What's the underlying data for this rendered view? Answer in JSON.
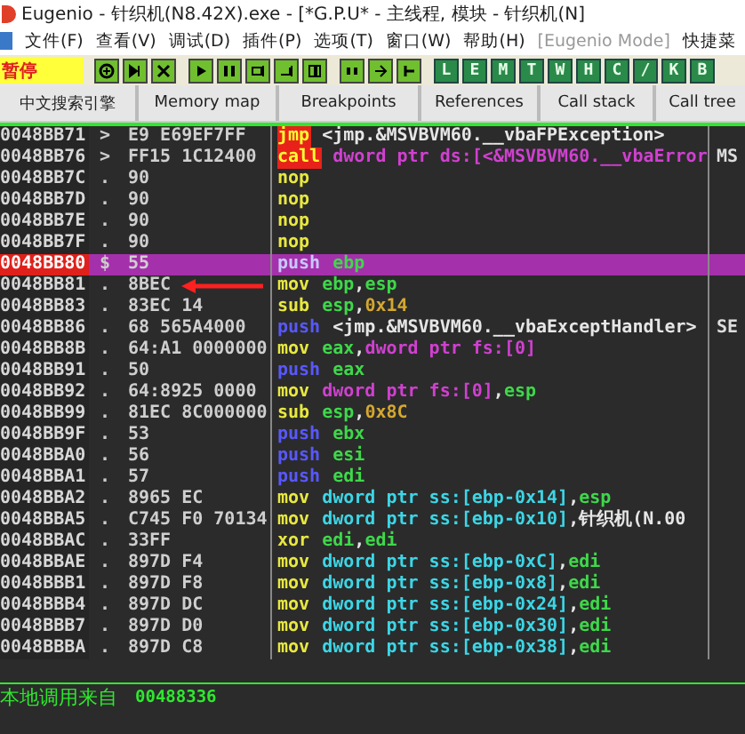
{
  "window": {
    "title": "Eugenio - 针织机(N8.42X).exe - [*G.P.U* - 主线程, 模块 - 针织机(N]"
  },
  "menu": [
    "文件(F)",
    "查看(V)",
    "调试(D)",
    "插件(P)",
    "选项(T)",
    "窗口(W)",
    "帮助(H)",
    "[Eugenio Mode]",
    "快捷菜"
  ],
  "toolbar": {
    "status": "暂停",
    "buttons": [
      {
        "kind": "icon"
      },
      {
        "kind": "icon"
      },
      {
        "kind": "icon"
      },
      {
        "kind": "icon"
      },
      {
        "kind": "icon"
      },
      {
        "kind": "icon"
      },
      {
        "kind": "icon"
      },
      {
        "kind": "icon"
      },
      {
        "kind": "icon"
      },
      {
        "kind": "icon"
      },
      {
        "kind": "icon"
      },
      {
        "kind": "letter",
        "label": "L"
      },
      {
        "kind": "letter",
        "label": "E"
      },
      {
        "kind": "letter",
        "label": "M"
      },
      {
        "kind": "letter",
        "label": "T"
      },
      {
        "kind": "letter",
        "label": "W"
      },
      {
        "kind": "letter",
        "label": "H"
      },
      {
        "kind": "letter",
        "label": "C"
      },
      {
        "kind": "letter",
        "label": "/"
      },
      {
        "kind": "letter",
        "label": "K"
      },
      {
        "kind": "letter",
        "label": "B"
      }
    ]
  },
  "tabs": [
    {
      "label": "中文搜索引擎",
      "selected": false
    },
    {
      "label": "Memory map",
      "selected": false
    },
    {
      "label": "Breakpoints",
      "selected": false
    },
    {
      "label": "References",
      "selected": false
    },
    {
      "label": "Call stack",
      "selected": false
    },
    {
      "label": "Call tree",
      "selected": false
    }
  ],
  "disasm": {
    "rows": [
      {
        "address": "0048BB71",
        "marker": ">",
        "bytes": "E9 E69EF7FF",
        "mnemonic": "jmp",
        "kind": "flow",
        "operands": [
          {
            "text": "<jmp.&MSVBVM60.__vbaFPException>",
            "kind": "sym"
          }
        ],
        "selected": false
      },
      {
        "address": "0048BB76",
        "marker": ">",
        "bytes": "FF15 1C12400",
        "mnemonic": "call",
        "kind": "flow",
        "operands": [
          {
            "text": "dword ptr ds:[<&MSVBVM60.__vbaError",
            "kind": "seg"
          }
        ],
        "comment": "MS",
        "selected": false
      },
      {
        "address": "0048BB7C",
        "marker": ".",
        "bytes": "90",
        "mnemonic": "nop",
        "kind": "plain",
        "operands": [],
        "selected": false
      },
      {
        "address": "0048BB7D",
        "marker": ".",
        "bytes": "90",
        "mnemonic": "nop",
        "kind": "plain",
        "operands": [],
        "selected": false
      },
      {
        "address": "0048BB7E",
        "marker": ".",
        "bytes": "90",
        "mnemonic": "nop",
        "kind": "plain",
        "operands": [],
        "selected": false
      },
      {
        "address": "0048BB7F",
        "marker": ".",
        "bytes": "90",
        "mnemonic": "nop",
        "kind": "plain",
        "operands": [],
        "selected": false
      },
      {
        "address": "0048BB80",
        "marker": "$",
        "bytes": "55",
        "mnemonic": "push",
        "kind": "stack",
        "operands": [
          {
            "text": "ebp",
            "kind": "reg"
          }
        ],
        "selected": true
      },
      {
        "address": "0048BB81",
        "marker": ".",
        "bytes": "8BEC",
        "mnemonic": "mov",
        "kind": "plain",
        "operands": [
          {
            "text": "ebp",
            "kind": "reg"
          },
          {
            "text": ",",
            "kind": "sym"
          },
          {
            "text": "esp",
            "kind": "reg"
          }
        ],
        "selected": false
      },
      {
        "address": "0048BB83",
        "marker": ".",
        "bytes": "83EC 14",
        "mnemonic": "sub",
        "kind": "plain",
        "operands": [
          {
            "text": "esp",
            "kind": "reg"
          },
          {
            "text": ",",
            "kind": "sym"
          },
          {
            "text": "0x14",
            "kind": "imm"
          }
        ],
        "selected": false
      },
      {
        "address": "0048BB86",
        "marker": ".",
        "bytes": "68 565A4000",
        "mnemonic": "push",
        "kind": "stack",
        "operands": [
          {
            "text": "<jmp.&MSVBVM60.__vbaExceptHandler>",
            "kind": "sym"
          }
        ],
        "comment": "SE",
        "selected": false
      },
      {
        "address": "0048BB8B",
        "marker": ".",
        "bytes": "64:A1 0000000",
        "mnemonic": "mov",
        "kind": "plain",
        "operands": [
          {
            "text": "eax",
            "kind": "reg"
          },
          {
            "text": ",",
            "kind": "sym"
          },
          {
            "text": "dword ptr fs:[0]",
            "kind": "seg"
          }
        ],
        "selected": false
      },
      {
        "address": "0048BB91",
        "marker": ".",
        "bytes": "50",
        "mnemonic": "push",
        "kind": "stack",
        "operands": [
          {
            "text": "eax",
            "kind": "reg"
          }
        ],
        "selected": false
      },
      {
        "address": "0048BB92",
        "marker": ".",
        "bytes": "64:8925 0000",
        "mnemonic": "mov",
        "kind": "plain",
        "operands": [
          {
            "text": "dword ptr fs:[0]",
            "kind": "seg"
          },
          {
            "text": ",",
            "kind": "sym"
          },
          {
            "text": "esp",
            "kind": "reg"
          }
        ],
        "selected": false
      },
      {
        "address": "0048BB99",
        "marker": ".",
        "bytes": "81EC 8C000000",
        "mnemonic": "sub",
        "kind": "plain",
        "operands": [
          {
            "text": "esp",
            "kind": "reg"
          },
          {
            "text": ",",
            "kind": "sym"
          },
          {
            "text": "0x8C",
            "kind": "imm"
          }
        ],
        "selected": false
      },
      {
        "address": "0048BB9F",
        "marker": ".",
        "bytes": "53",
        "mnemonic": "push",
        "kind": "stack",
        "operands": [
          {
            "text": "ebx",
            "kind": "reg"
          }
        ],
        "selected": false
      },
      {
        "address": "0048BBA0",
        "marker": ".",
        "bytes": "56",
        "mnemonic": "push",
        "kind": "stack",
        "operands": [
          {
            "text": "esi",
            "kind": "reg"
          }
        ],
        "selected": false
      },
      {
        "address": "0048BBA1",
        "marker": ".",
        "bytes": "57",
        "mnemonic": "push",
        "kind": "stack",
        "operands": [
          {
            "text": "edi",
            "kind": "reg"
          }
        ],
        "selected": false
      },
      {
        "address": "0048BBA2",
        "marker": ".",
        "bytes": "8965 EC",
        "mnemonic": "mov",
        "kind": "plain",
        "operands": [
          {
            "text": "dword ptr ss:[ebp-0x14]",
            "kind": "mem"
          },
          {
            "text": ",",
            "kind": "sym"
          },
          {
            "text": "esp",
            "kind": "reg"
          }
        ],
        "selected": false
      },
      {
        "address": "0048BBA5",
        "marker": ".",
        "bytes": "C745 F0 70134",
        "mnemonic": "mov",
        "kind": "plain",
        "operands": [
          {
            "text": "dword ptr ss:[ebp-0x10]",
            "kind": "mem"
          },
          {
            "text": ",针织机(N.00",
            "kind": "sym"
          }
        ],
        "selected": false
      },
      {
        "address": "0048BBAC",
        "marker": ".",
        "bytes": "33FF",
        "mnemonic": "xor",
        "kind": "plain",
        "operands": [
          {
            "text": "edi",
            "kind": "reg"
          },
          {
            "text": ",",
            "kind": "sym"
          },
          {
            "text": "edi",
            "kind": "reg"
          }
        ],
        "selected": false
      },
      {
        "address": "0048BBAE",
        "marker": ".",
        "bytes": "897D F4",
        "mnemonic": "mov",
        "kind": "plain",
        "operands": [
          {
            "text": "dword ptr ss:[ebp-0xC]",
            "kind": "mem"
          },
          {
            "text": ",",
            "kind": "sym"
          },
          {
            "text": "edi",
            "kind": "reg"
          }
        ],
        "selected": false
      },
      {
        "address": "0048BBB1",
        "marker": ".",
        "bytes": "897D F8",
        "mnemonic": "mov",
        "kind": "plain",
        "operands": [
          {
            "text": "dword ptr ss:[ebp-0x8]",
            "kind": "mem"
          },
          {
            "text": ",",
            "kind": "sym"
          },
          {
            "text": "edi",
            "kind": "reg"
          }
        ],
        "selected": false
      },
      {
        "address": "0048BBB4",
        "marker": ".",
        "bytes": "897D DC",
        "mnemonic": "mov",
        "kind": "plain",
        "operands": [
          {
            "text": "dword ptr ss:[ebp-0x24]",
            "kind": "mem"
          },
          {
            "text": ",",
            "kind": "sym"
          },
          {
            "text": "edi",
            "kind": "reg"
          }
        ],
        "selected": false
      },
      {
        "address": "0048BBB7",
        "marker": ".",
        "bytes": "897D D0",
        "mnemonic": "mov",
        "kind": "plain",
        "operands": [
          {
            "text": "dword ptr ss:[ebp-0x30]",
            "kind": "mem"
          },
          {
            "text": ",",
            "kind": "sym"
          },
          {
            "text": "edi",
            "kind": "reg"
          }
        ],
        "selected": false
      },
      {
        "address": "0048BBBA",
        "marker": ".",
        "bytes": "897D C8",
        "mnemonic": "mov",
        "kind": "plain",
        "operands": [
          {
            "text": "dword ptr ss:[ebp-0x38]",
            "kind": "mem"
          },
          {
            "text": ",",
            "kind": "sym"
          },
          {
            "text": "edi",
            "kind": "reg"
          }
        ],
        "selected": false
      }
    ]
  },
  "status": {
    "label": "本地调用来自",
    "address": "00488336"
  }
}
